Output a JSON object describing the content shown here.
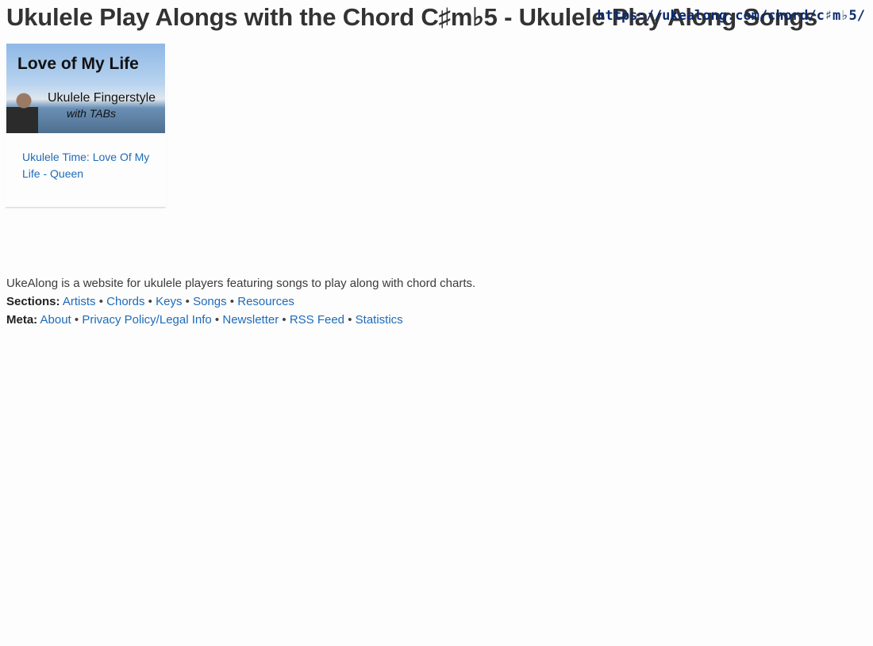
{
  "header": {
    "title": "Ukulele Play Alongs with the Chord C♯m♭5 - Ukulele Play Along Songs",
    "url": "https://ukealong.com/chord/c♯m♭5/"
  },
  "card": {
    "image_text": {
      "line1": "Love of My Life",
      "line2": "Ukulele Fingerstyle",
      "line3": "with TABs"
    },
    "link_label": "Ukulele Time: Love Of My Life - Queen"
  },
  "footer": {
    "description": "UkeAlong is a website for ukulele players featuring songs to play along with chord charts.",
    "sections_label": "Sections:",
    "sections": [
      "Artists",
      "Chords",
      "Keys",
      "Songs",
      "Resources"
    ],
    "meta_label": "Meta:",
    "meta": [
      "About",
      "Privacy Policy/Legal Info",
      "Newsletter",
      "RSS Feed",
      "Statistics"
    ],
    "separator": "•"
  }
}
